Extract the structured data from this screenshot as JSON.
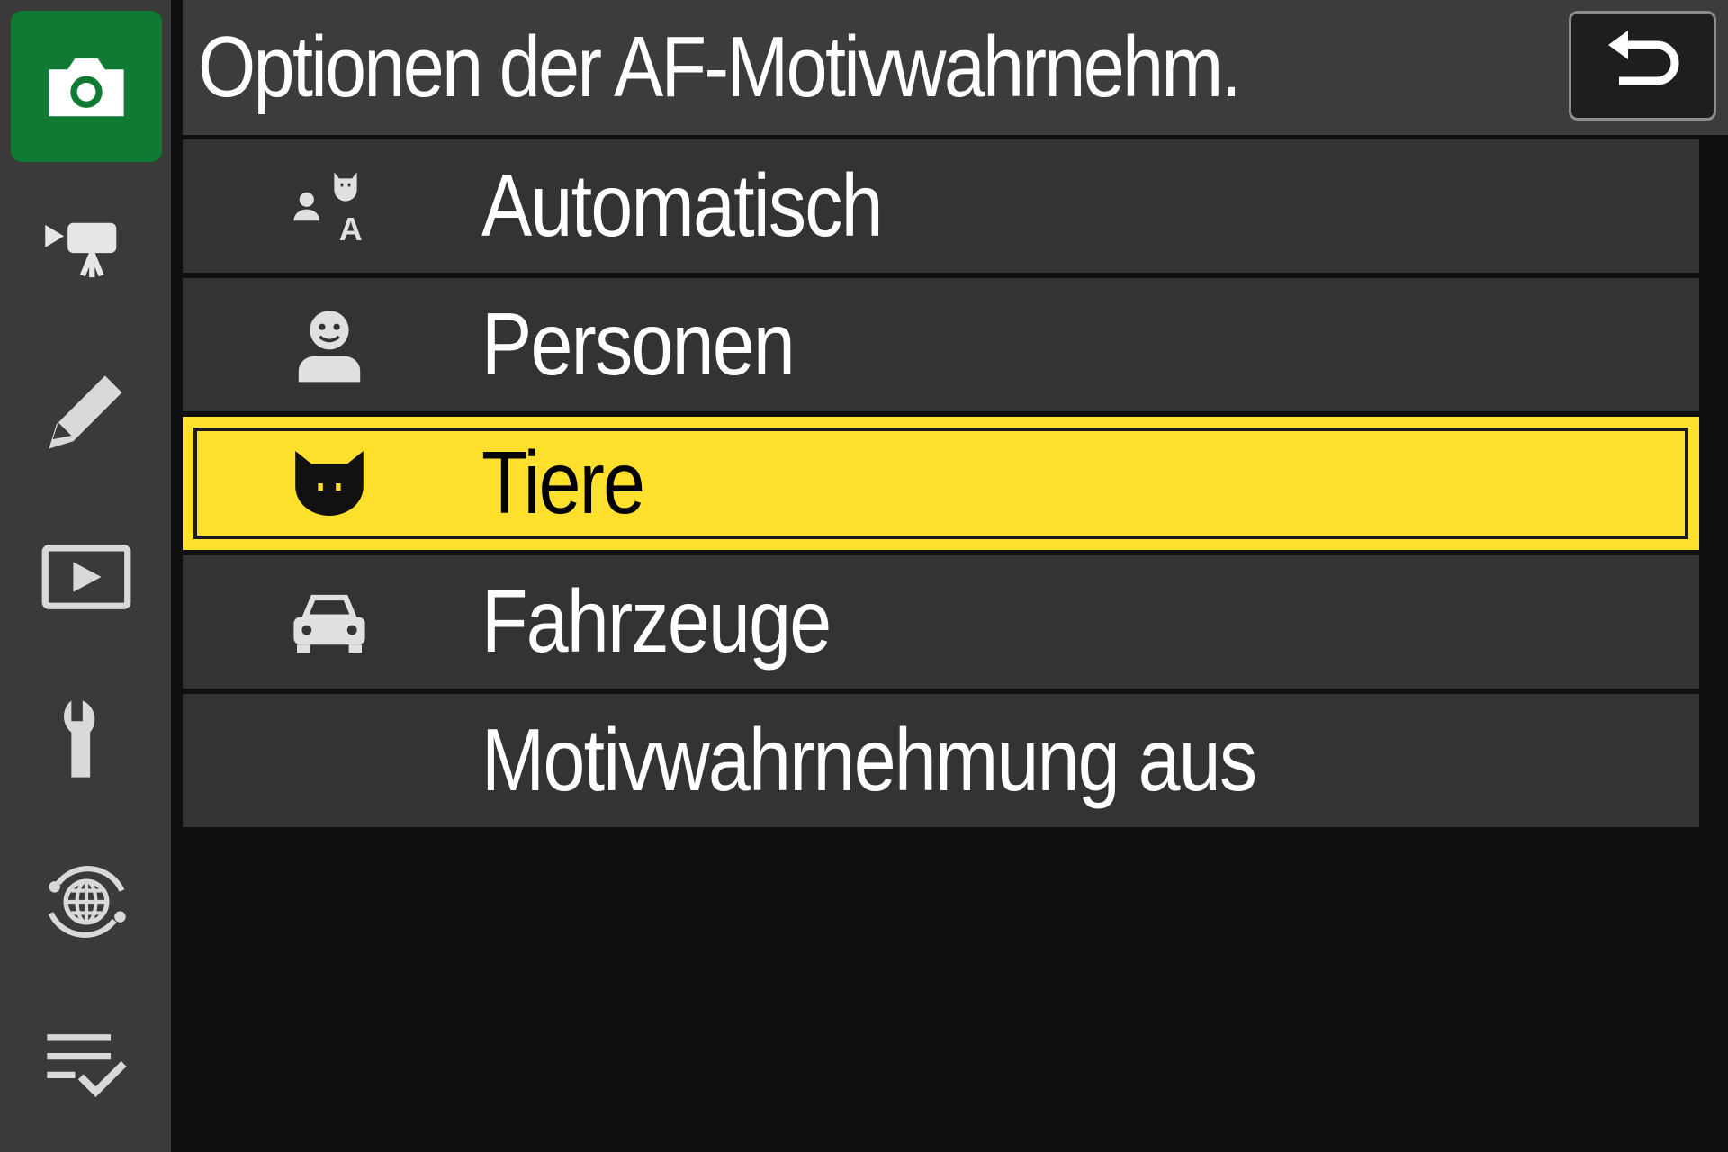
{
  "colors": {
    "sidebar_bg": "#3a3a3a",
    "sidebar_active": "#0e7a32",
    "title_bg": "#3c3c3c",
    "row_bg": "#333333",
    "row_selected": "#ffe12d",
    "background": "#0f0f0f"
  },
  "sidebar": {
    "items": [
      {
        "icon": "camera-icon",
        "active": true
      },
      {
        "icon": "movie-camera-icon",
        "active": false
      },
      {
        "icon": "pencil-icon",
        "active": false
      },
      {
        "icon": "playback-icon",
        "active": false
      },
      {
        "icon": "wrench-icon",
        "active": false
      },
      {
        "icon": "network-globe-icon",
        "active": false
      },
      {
        "icon": "my-menu-checklist-icon",
        "active": false
      }
    ]
  },
  "header": {
    "title": "Optionen der AF-Motivwahrnehm.",
    "back_icon": "return-arrow-icon"
  },
  "menu": {
    "selected_index": 2,
    "items": [
      {
        "label": "Automatisch",
        "icon": "auto-subject-icon"
      },
      {
        "label": "Personen",
        "icon": "person-icon"
      },
      {
        "label": "Tiere",
        "icon": "animal-icon"
      },
      {
        "label": "Fahrzeuge",
        "icon": "car-icon"
      },
      {
        "label": "Motivwahrnehmung aus",
        "icon": ""
      }
    ]
  }
}
